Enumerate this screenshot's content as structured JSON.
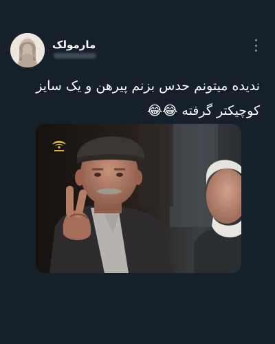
{
  "post": {
    "author_name": "مارمولک",
    "text_line1": "ندیده میتونم حدس بزنم پیرهن و یک سایز",
    "text_line2": "کوچیکتر گرفته 😂😂"
  },
  "icons": {
    "more": "more-vertical-icon",
    "channel_logo": "tv-channel-logo"
  },
  "colors": {
    "background": "#15202b",
    "text_primary": "#ffffff",
    "text_secondary": "#8899a6"
  }
}
